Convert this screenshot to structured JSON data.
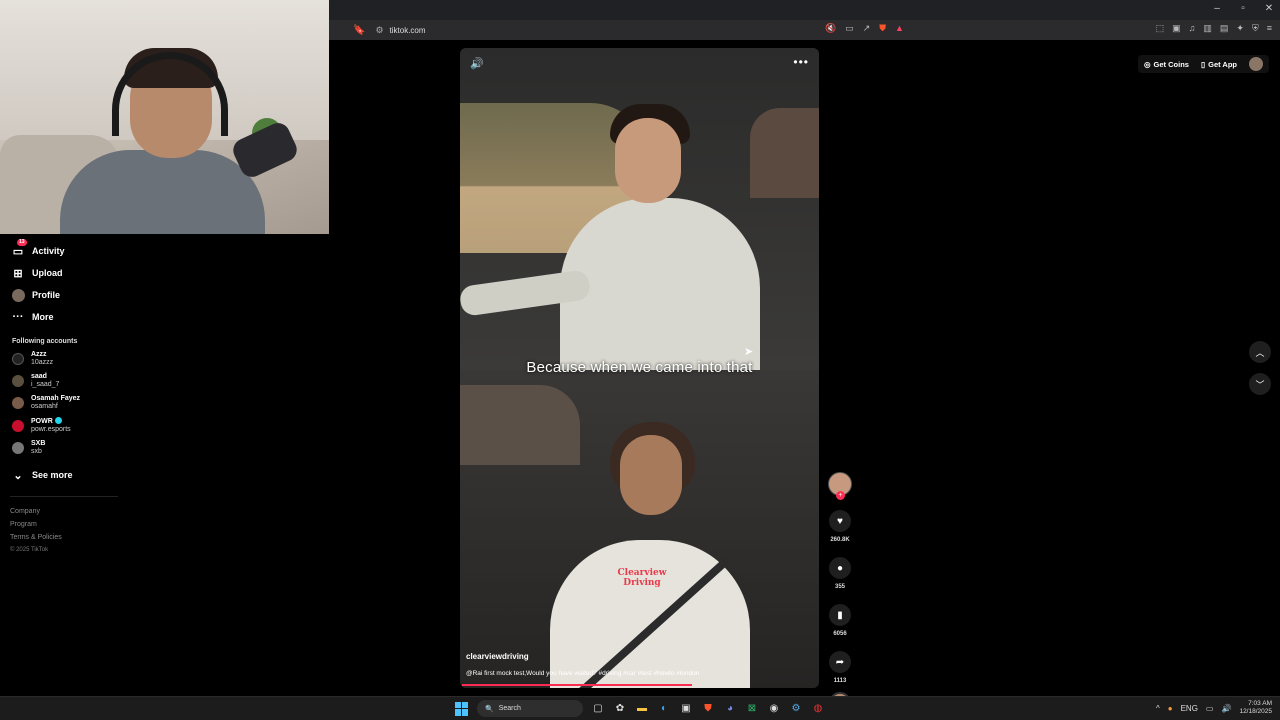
{
  "browser": {
    "url": "tiktok.com",
    "window_controls": [
      "–",
      "▫",
      "✕"
    ]
  },
  "sidebar": {
    "nav": [
      {
        "label": "Activity",
        "badge": "13"
      },
      {
        "label": "Upload"
      },
      {
        "label": "Profile"
      },
      {
        "label": "More"
      }
    ],
    "following_title": "Following accounts",
    "following": [
      {
        "name": "Azzz",
        "handle": "10azzz",
        "color": "#222222"
      },
      {
        "name": "saad",
        "handle": "i_saad_7",
        "color": "#5b5040"
      },
      {
        "name": "Osamah Fayez",
        "handle": "osamahf",
        "color": "#7a5a48"
      },
      {
        "name": "POWR",
        "handle": "powr.esports",
        "color": "#c8102e",
        "verified": true
      },
      {
        "name": "SXB",
        "handle": "sxb",
        "color": "#777777"
      }
    ],
    "see_more": "See more",
    "footer": [
      "Company",
      "Program",
      "Terms & Policies"
    ],
    "copyright": "© 2025 TikTok"
  },
  "video": {
    "caption": "Because when we came into that",
    "shirt_logo": "Clearview Driving",
    "author": "clearviewdriving",
    "description": "@Rai first mock test,Would you have waited? #driving #car #test #howto #london",
    "progress": 0.64
  },
  "actions": {
    "likes": "260.8K",
    "comments": "355",
    "saves": "6056",
    "shares": "1113"
  },
  "header": {
    "get_coins": "Get Coins",
    "get_app": "Get App"
  },
  "taskbar": {
    "search_placeholder": "Search",
    "lang": "ENG",
    "time": "7:03 AM",
    "date": "12/18/2025"
  }
}
